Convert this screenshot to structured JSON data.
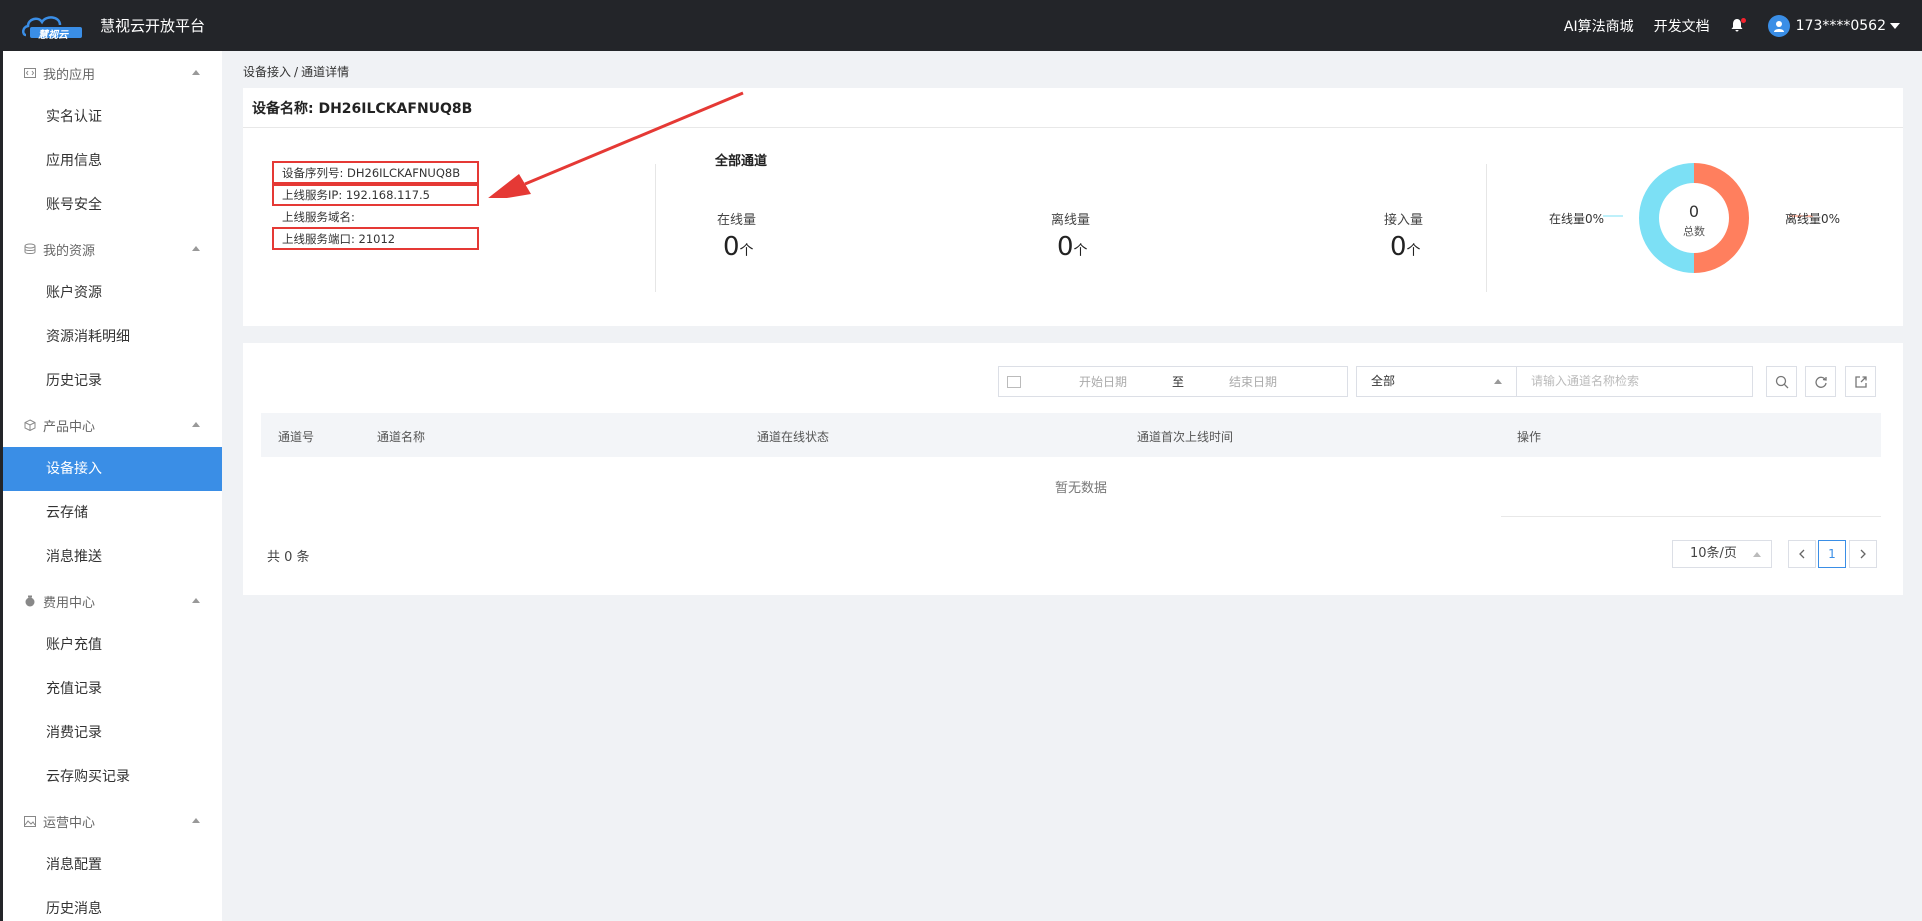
{
  "header": {
    "logo_text": "慧视云",
    "title": "慧视云开放平台",
    "links": [
      "AI算法商城",
      "开发文档"
    ],
    "user": "173****0562"
  },
  "sidebar": {
    "groups": [
      {
        "label": "我的应用",
        "icon": "code-icon",
        "items": [
          "实名认证",
          "应用信息",
          "账号安全"
        ]
      },
      {
        "label": "我的资源",
        "icon": "database-icon",
        "items": [
          "账户资源",
          "资源消耗明细",
          "历史记录"
        ]
      },
      {
        "label": "产品中心",
        "icon": "cube-icon",
        "items": [
          "设备接入",
          "云存储",
          "消息推送"
        ]
      },
      {
        "label": "费用中心",
        "icon": "money-bag-icon",
        "items": [
          "账户充值",
          "充值记录",
          "消费记录",
          "云存购买记录"
        ]
      },
      {
        "label": "运营中心",
        "icon": "image-icon",
        "items": [
          "消息配置",
          "历史消息"
        ]
      }
    ],
    "active_item": "设备接入"
  },
  "breadcrumb": {
    "parent": "设备接入",
    "sep": "/",
    "current": "通道详情"
  },
  "device": {
    "heading": "设备名称: DH26ILCKAFNUQ8B",
    "serial": "设备序列号: DH26ILCKAFNUQ8B",
    "ip": "上线服务IP: 192.168.117.5",
    "domain": "上线服务域名:",
    "port": "上线服务端口: 21012"
  },
  "channels": {
    "title": "全部通道",
    "stats": [
      {
        "label": "在线量",
        "value": "0",
        "unit": "个"
      },
      {
        "label": "离线量",
        "value": "0",
        "unit": "个"
      },
      {
        "label": "接入量",
        "value": "0",
        "unit": "个"
      }
    ],
    "donut": {
      "total": "0",
      "total_label": "总数",
      "online_label": "在线量0%",
      "offline_label": "离线量0%",
      "online_color": "#7ce0f5",
      "offline_color": "#ff7f5e"
    }
  },
  "filters": {
    "start_placeholder": "开始日期",
    "range_sep": "至",
    "end_placeholder": "结束日期",
    "status_select": "全部",
    "search_placeholder": "请输入通道名称检索"
  },
  "table": {
    "columns": [
      "通道号",
      "通道名称",
      "通道在线状态",
      "通道首次上线时间",
      "操作"
    ],
    "empty_text": "暂无数据"
  },
  "pagination": {
    "total": "共 0 条",
    "page_size": "10条/页",
    "current_page": "1"
  },
  "colors": {
    "accent": "#3a8ee6",
    "topbar": "#232529",
    "annotation_red": "#e53935"
  }
}
